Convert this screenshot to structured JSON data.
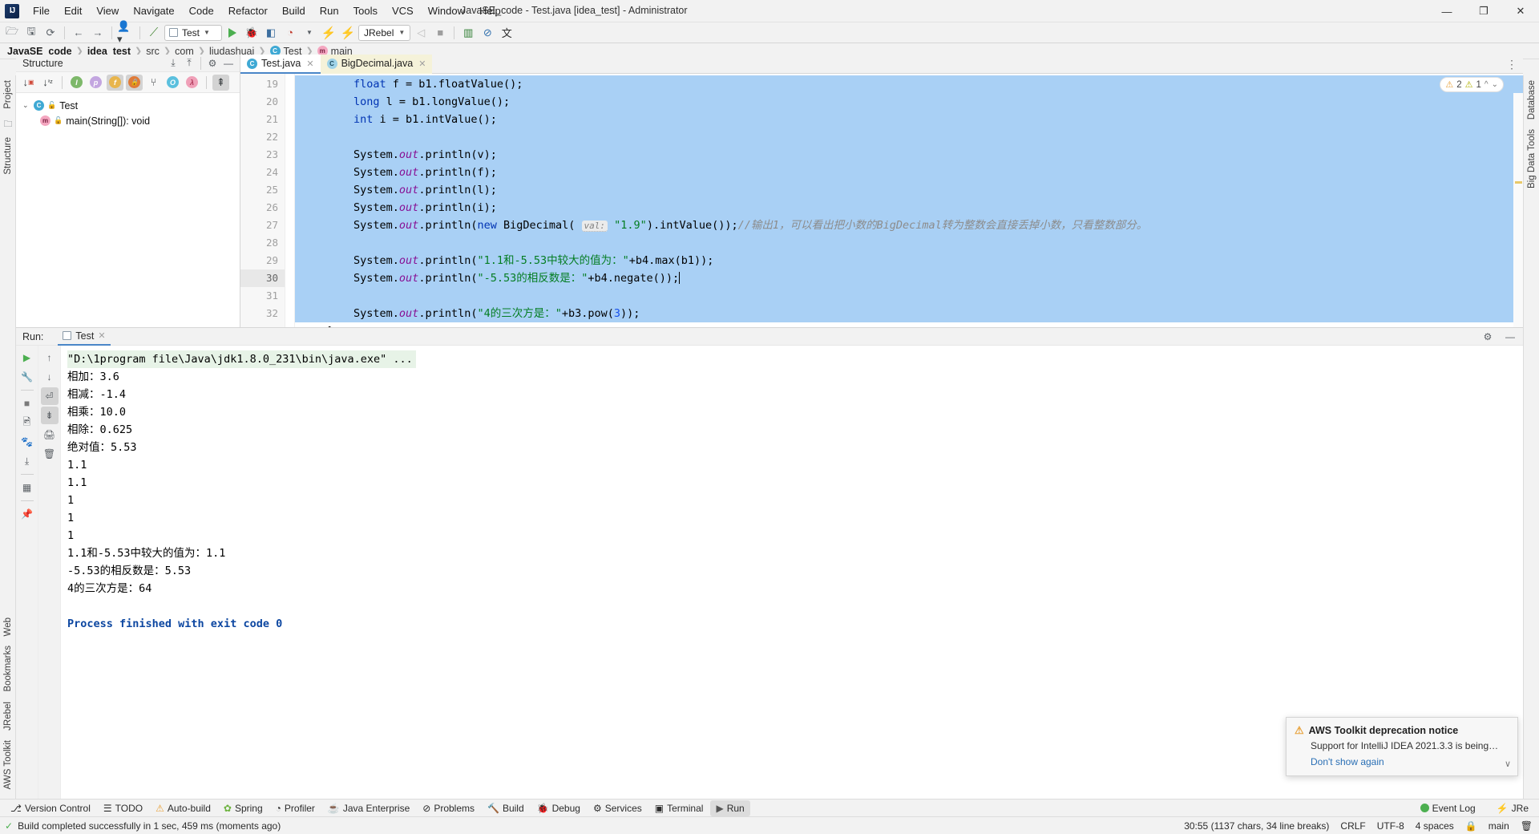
{
  "window": {
    "title": "JavaSE_code - Test.java [idea_test] - Administrator",
    "logo": "IJ",
    "minimize": "—",
    "maximize": "❐",
    "close": "✕"
  },
  "menubar": [
    {
      "label": "File"
    },
    {
      "label": "Edit"
    },
    {
      "label": "View"
    },
    {
      "label": "Navigate"
    },
    {
      "label": "Code"
    },
    {
      "label": "Refactor"
    },
    {
      "label": "Build"
    },
    {
      "label": "Run"
    },
    {
      "label": "Tools"
    },
    {
      "label": "VCS"
    },
    {
      "label": "Window"
    },
    {
      "label": "Help"
    }
  ],
  "toolbar": {
    "open_icon": "὜1",
    "save_icon": "⬚",
    "sync_icon": "⟳",
    "back_icon": "←",
    "forward_icon": "→",
    "profile_icon": "὆4",
    "build_icon": "⚒",
    "run_config": "Test",
    "run_icon": "▶",
    "debug_icon": "ὁE",
    "coverage_icon": "⏺",
    "profiler_icon": "⚡",
    "jrebel_label": "JRebel",
    "jrebel_run_icon": "⚡",
    "stop_icon": "■",
    "monitor_icon": "Ὄ8",
    "forbid_icon": "⊘",
    "translate_icon": "文A"
  },
  "breadcrumb": [
    {
      "label": "JavaSE_code",
      "bold": true,
      "icon": ""
    },
    {
      "label": "idea_test",
      "bold": true,
      "icon": ""
    },
    {
      "label": "src",
      "bold": false,
      "icon": ""
    },
    {
      "label": "com",
      "bold": false,
      "icon": ""
    },
    {
      "label": "liudashuai",
      "bold": false,
      "icon": ""
    },
    {
      "label": "Test",
      "bold": false,
      "icon": "C"
    },
    {
      "label": "main",
      "bold": false,
      "icon": "m"
    }
  ],
  "left_strip": {
    "project_tab": "Project",
    "structure_tab": "Structure",
    "bookmarks_tab": "Bookmarks",
    "jrebel_tab": "JRebel",
    "aws_tab": "AWS Toolkit",
    "web_tab": "Web",
    "favorites_icon": "Ὄ1"
  },
  "right_strip": {
    "database_tab": "Database",
    "bigdata_tab": "Big Data Tools"
  },
  "structure": {
    "title": "Structure",
    "expand_icon": "⤓",
    "collapse_icon": "⤒",
    "settings_icon": "⚙",
    "hide_icon": "—",
    "filters": [
      {
        "name": "sort-by-visibility",
        "glyph": "↓",
        "sub": "■",
        "active": false
      },
      {
        "name": "sort-alphabetically",
        "glyph": "↓",
        "sub": "az",
        "active": false
      },
      {
        "name": "show-inherited",
        "glyph": "I",
        "color": "#7db86a",
        "active": false
      },
      {
        "name": "show-properties",
        "glyph": "p",
        "color": "#c3a6e0",
        "active": false
      },
      {
        "name": "show-fields",
        "glyph": "f",
        "color": "#e8b54d",
        "active": true
      },
      {
        "name": "show-non-public",
        "glyph": "ὑ2",
        "color": "#e07b39",
        "active": true
      },
      {
        "name": "group-by-type",
        "glyph": "⑂",
        "color": "#666666",
        "active": false
      },
      {
        "name": "show-anonymous",
        "glyph": "O",
        "color": "#5bc0de",
        "active": false
      },
      {
        "name": "show-lambdas",
        "glyph": "λ",
        "color": "#f0a0b8",
        "active": false
      },
      {
        "name": "autoscroll-to-source",
        "glyph": "↧",
        "color": "#5b6065",
        "active": true
      }
    ],
    "tree": [
      {
        "label": "Test",
        "icon": "C",
        "kind": "class",
        "indent": 0,
        "expanded": true
      },
      {
        "label": "main(String[]): void",
        "icon": "m",
        "kind": "method",
        "indent": 1,
        "expanded": false
      }
    ]
  },
  "editor": {
    "tabs": [
      {
        "label": "Test.java",
        "icon": "C",
        "active": true,
        "modified": false
      },
      {
        "label": "BigDecimal.java",
        "icon": "C",
        "active": false,
        "modified": true
      }
    ],
    "inspection": {
      "warnings": "2",
      "weak_warnings": "1",
      "warn_icon": "⚠",
      "chevron": "⌃",
      "expand": "∨"
    },
    "first_line_number": 19,
    "caret_line": 30,
    "bulb_line": 30,
    "lines": [
      {
        "n": 19,
        "selected": true,
        "tokens": [
          {
            "t": "        ",
            "c": ""
          },
          {
            "t": "float",
            "c": "kw"
          },
          {
            "t": " f = b1.floatValue();",
            "c": ""
          }
        ]
      },
      {
        "n": 20,
        "selected": true,
        "tokens": [
          {
            "t": "        ",
            "c": ""
          },
          {
            "t": "long",
            "c": "kw"
          },
          {
            "t": " l = b1.longValue();",
            "c": ""
          }
        ]
      },
      {
        "n": 21,
        "selected": true,
        "tokens": [
          {
            "t": "        ",
            "c": ""
          },
          {
            "t": "int",
            "c": "kw"
          },
          {
            "t": " i = b1.intValue();",
            "c": ""
          }
        ]
      },
      {
        "n": 22,
        "selected": true,
        "tokens": []
      },
      {
        "n": 23,
        "selected": true,
        "tokens": [
          {
            "t": "        System.",
            "c": ""
          },
          {
            "t": "out",
            "c": "fld"
          },
          {
            "t": ".println(v);",
            "c": ""
          }
        ]
      },
      {
        "n": 24,
        "selected": true,
        "tokens": [
          {
            "t": "        System.",
            "c": ""
          },
          {
            "t": "out",
            "c": "fld"
          },
          {
            "t": ".println(f);",
            "c": ""
          }
        ]
      },
      {
        "n": 25,
        "selected": true,
        "tokens": [
          {
            "t": "        System.",
            "c": ""
          },
          {
            "t": "out",
            "c": "fld"
          },
          {
            "t": ".println(l);",
            "c": ""
          }
        ]
      },
      {
        "n": 26,
        "selected": true,
        "tokens": [
          {
            "t": "        System.",
            "c": ""
          },
          {
            "t": "out",
            "c": "fld"
          },
          {
            "t": ".println(i);",
            "c": ""
          }
        ]
      },
      {
        "n": 27,
        "selected": true,
        "tokens": [
          {
            "t": "        System.",
            "c": ""
          },
          {
            "t": "out",
            "c": "fld"
          },
          {
            "t": ".println(",
            "c": ""
          },
          {
            "t": "new",
            "c": "kw"
          },
          {
            "t": " BigDecimal( ",
            "c": ""
          },
          {
            "t": "val:",
            "c": "hint"
          },
          {
            "t": " ",
            "c": ""
          },
          {
            "t": "\"1.9\"",
            "c": "str"
          },
          {
            "t": ").intValue());",
            "c": ""
          },
          {
            "t": "//输出1，可以看出把小数的BigDecimal转为整数会直接丢掉小数，只看整数部分。",
            "c": "cmt"
          }
        ]
      },
      {
        "n": 28,
        "selected": true,
        "tokens": []
      },
      {
        "n": 29,
        "selected": true,
        "tokens": [
          {
            "t": "        System.",
            "c": ""
          },
          {
            "t": "out",
            "c": "fld"
          },
          {
            "t": ".println(",
            "c": ""
          },
          {
            "t": "\"1.1和-5.53中较大的值为：\"",
            "c": "str"
          },
          {
            "t": "+b4.max(b1));",
            "c": ""
          }
        ]
      },
      {
        "n": 30,
        "selected": true,
        "caret": true,
        "tokens": [
          {
            "t": "        System.",
            "c": ""
          },
          {
            "t": "out",
            "c": "fld"
          },
          {
            "t": ".println(",
            "c": ""
          },
          {
            "t": "\"-5.53的相反数是：\"",
            "c": "str"
          },
          {
            "t": "+b4.negate());",
            "c": ""
          }
        ]
      },
      {
        "n": 31,
        "selected": true,
        "tokens": []
      },
      {
        "n": 32,
        "selected": true,
        "tokens": [
          {
            "t": "        System.",
            "c": ""
          },
          {
            "t": "out",
            "c": "fld"
          },
          {
            "t": ".println(",
            "c": ""
          },
          {
            "t": "\"4的三次方是：\"",
            "c": "str"
          },
          {
            "t": "+b3.pow(",
            "c": ""
          },
          {
            "t": "3",
            "c": "num"
          },
          {
            "t": "));",
            "c": ""
          }
        ]
      },
      {
        "n": 33,
        "selected": false,
        "tokens": [
          {
            "t": "    }",
            "c": ""
          }
        ]
      }
    ]
  },
  "run": {
    "label": "Run:",
    "tab": "Test",
    "tab_close": "✕",
    "settings_icon": "⚙",
    "hide_icon": "—",
    "tools": [
      {
        "name": "rerun",
        "glyph": "▶",
        "color": "#4caf50",
        "active": false
      },
      {
        "name": "fix-settings",
        "glyph": "ὒ7",
        "color": "#5b6065",
        "active": false
      },
      {
        "name": "stop",
        "glyph": "■",
        "color": "#7a7a7a",
        "active": false
      },
      {
        "name": "screenshot",
        "glyph": "὏7",
        "color": "#5b6065",
        "active": false
      },
      {
        "name": "thread-dump",
        "glyph": "ὁE",
        "color": "#5b6065",
        "active": false
      },
      {
        "name": "export",
        "glyph": "↳",
        "color": "#5b6065",
        "active": false
      },
      {
        "name": "layout",
        "glyph": "▦",
        "color": "#5b6065",
        "active": false
      },
      {
        "name": "pin",
        "glyph": "ὌC",
        "color": "#5b6065",
        "active": false
      }
    ],
    "tools2": [
      {
        "name": "scroll-up",
        "glyph": "↑",
        "active": false
      },
      {
        "name": "scroll-down",
        "glyph": "↓",
        "active": false
      },
      {
        "name": "soft-wrap",
        "glyph": "↵",
        "active": true
      },
      {
        "name": "scroll-to-end",
        "glyph": "↧",
        "active": true
      },
      {
        "name": "print",
        "glyph": "὚8",
        "active": false
      },
      {
        "name": "clear-all",
        "glyph": "Ὕ1",
        "active": false
      }
    ],
    "console": [
      {
        "text": "\"D:\\1program file\\Java\\jdk1.8.0_231\\bin\\java.exe\" ...",
        "style": "cmd"
      },
      {
        "text": "相加：3.6",
        "style": ""
      },
      {
        "text": "相减：-1.4",
        "style": ""
      },
      {
        "text": "相乘：10.0",
        "style": ""
      },
      {
        "text": "相除：0.625",
        "style": ""
      },
      {
        "text": "绝对值：5.53",
        "style": ""
      },
      {
        "text": "1.1",
        "style": ""
      },
      {
        "text": "1.1",
        "style": ""
      },
      {
        "text": "1",
        "style": ""
      },
      {
        "text": "1",
        "style": ""
      },
      {
        "text": "1",
        "style": ""
      },
      {
        "text": "1.1和-5.53中较大的值为：1.1",
        "style": ""
      },
      {
        "text": "-5.53的相反数是：5.53",
        "style": ""
      },
      {
        "text": "4的三次方是：64",
        "style": ""
      },
      {
        "text": "",
        "style": ""
      },
      {
        "text": "Process finished with exit code 0",
        "style": "ok"
      }
    ]
  },
  "notification": {
    "warn_icon": "⚠",
    "title": "AWS Toolkit deprecation notice",
    "body": "Support for IntelliJ IDEA 2021.3.3 is being…",
    "link": "Don't show again",
    "chevron": "∨"
  },
  "toolwindows": [
    {
      "label": "Version Control",
      "icon": "⎇",
      "active": false
    },
    {
      "label": "TODO",
      "icon": "≡",
      "active": false
    },
    {
      "label": "Auto-build",
      "icon": "⚠",
      "active": false
    },
    {
      "label": "Spring",
      "icon": "❀",
      "active": false
    },
    {
      "label": "Profiler",
      "icon": "◴",
      "active": false
    },
    {
      "label": "Java Enterprise",
      "icon": "☕",
      "active": false
    },
    {
      "label": "Problems",
      "icon": "⊘",
      "active": false
    },
    {
      "label": "Build",
      "icon": "ὒ8",
      "active": false
    },
    {
      "label": "Debug",
      "icon": "ὁE",
      "active": false
    },
    {
      "label": "Services",
      "icon": "⚙",
      "active": false
    },
    {
      "label": "Terminal",
      "icon": "▣",
      "active": false
    },
    {
      "label": "Run",
      "icon": "▶",
      "active": true
    }
  ],
  "toolwindows_right": [
    {
      "label": "Event Log",
      "icon": "≡"
    },
    {
      "label": "JRe",
      "icon": "⚡"
    }
  ],
  "statusbar": {
    "message": "Build completed successfully in 1 sec, 459 ms (moments ago)",
    "build_icon": "✓",
    "caret_pos": "30:55 (1137 chars, 34 line breaks)",
    "line_sep": "CRLF",
    "encoding": "UTF-8",
    "indent": "4 spaces",
    "branch": "main",
    "lock_icon": "ὑ2",
    "trash_icon": "Ὕ1"
  },
  "colors": {
    "accent": "#4a86c8",
    "selection": "#a9d0f5",
    "keyword": "#0033b3",
    "string": "#047d22",
    "field": "#871094",
    "comment": "#8c8c8c",
    "console_cmd_bg": "#e7f3e7",
    "ok_text": "#0d47a1",
    "warning": "#e8a33d"
  }
}
